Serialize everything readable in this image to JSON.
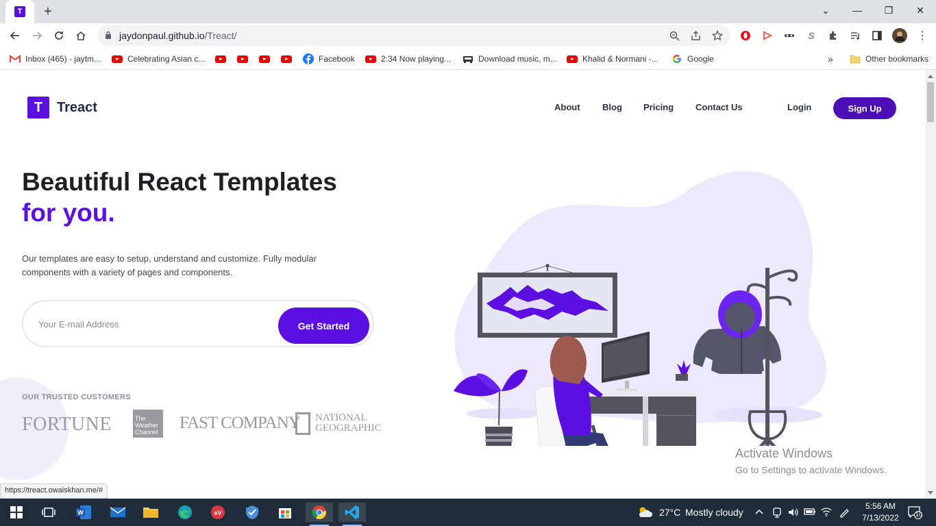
{
  "browser": {
    "tab_favicon": "T",
    "new_tab": "+",
    "window_controls": {
      "dropdown": "⌄",
      "minimize": "—",
      "restore": "❐",
      "close": "✕"
    },
    "url_host": "jaydonpaul.github.io",
    "url_path": "/Treact/",
    "bookmarks": [
      {
        "label": "Inbox (465) - jaytm...",
        "icon": "gmail-icon"
      },
      {
        "label": "Celebrating Asian c...",
        "icon": "youtube-icon"
      },
      {
        "label": "Facebook",
        "icon": "facebook-icon"
      },
      {
        "label": "2:34 Now playing...",
        "icon": "youtube-icon"
      },
      {
        "label": "Download music, m...",
        "icon": "music-icon"
      },
      {
        "label": "Khalid & Normani -...",
        "icon": "youtube-icon"
      },
      {
        "label": "Google",
        "icon": "google-icon"
      }
    ],
    "more_bookmarks": "»",
    "other_bookmarks": "Other bookmarks"
  },
  "page": {
    "logo_mark": "T",
    "logo_text": "Treact",
    "nav": {
      "about": "About",
      "blog": "Blog",
      "pricing": "Pricing",
      "contact": "Contact Us",
      "login": "Login",
      "signup": "Sign Up"
    },
    "hero": {
      "heading_line1": "Beautiful React Templates",
      "heading_line2": "for you.",
      "description": "Our templates are easy to setup, understand and customize. Fully modular components with a variety of pages and components.",
      "email_placeholder": "Your E-mail Address",
      "cta": "Get Started"
    },
    "trusted": {
      "label": "OUR TRUSTED CUSTOMERS",
      "fortune": "FORTUNE",
      "weather": "The Weather Channel",
      "fastcompany": "FAST COMPANY",
      "natgeo_line1": "NATIONAL",
      "natgeo_line2": "GEOGRAPHIC"
    },
    "status_link": "https://treact.owaiskhan.me/#",
    "activate_title": "Activate Windows",
    "activate_sub": "Go to Settings to activate Windows."
  },
  "colors": {
    "brand_purple": "#5b0fe0",
    "signup_purple": "#4c0fb5",
    "heading_dark": "#1f1f24",
    "taskbar_bg": "#1f2d3a"
  },
  "taskbar": {
    "weather_temp": "27°C",
    "weather_desc": "Mostly cloudy",
    "time": "5:56 AM",
    "date": "7/13/2022",
    "notification_count": "10"
  }
}
